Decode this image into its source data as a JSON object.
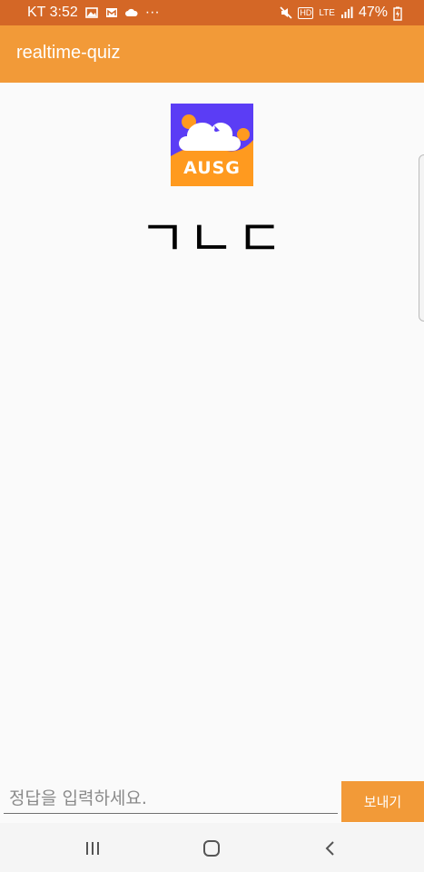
{
  "status_bar": {
    "carrier_time": "KT 3:52",
    "more": "···",
    "hd": "HD",
    "network": "LTE",
    "battery": "47%"
  },
  "app_bar": {
    "title": "realtime-quiz"
  },
  "logo": {
    "text": "AUSG"
  },
  "quiz": {
    "hint": "ㄱㄴㄷ"
  },
  "answer": {
    "placeholder": "정답을 입력하세요.",
    "value": ""
  },
  "send_button": {
    "label": "보내기"
  },
  "colors": {
    "status_bar": "#d46726",
    "app_bar": "#f29a38",
    "logo_purple": "#5b3df5",
    "logo_orange": "#ff9a1f",
    "send_button": "#f29a38"
  },
  "icons": {
    "status": [
      "gallery-icon",
      "email-icon",
      "cloud-icon",
      "mute-icon",
      "signal-icon",
      "battery-charging-icon"
    ],
    "nav": [
      "recent-apps-icon",
      "home-icon",
      "back-icon"
    ]
  }
}
